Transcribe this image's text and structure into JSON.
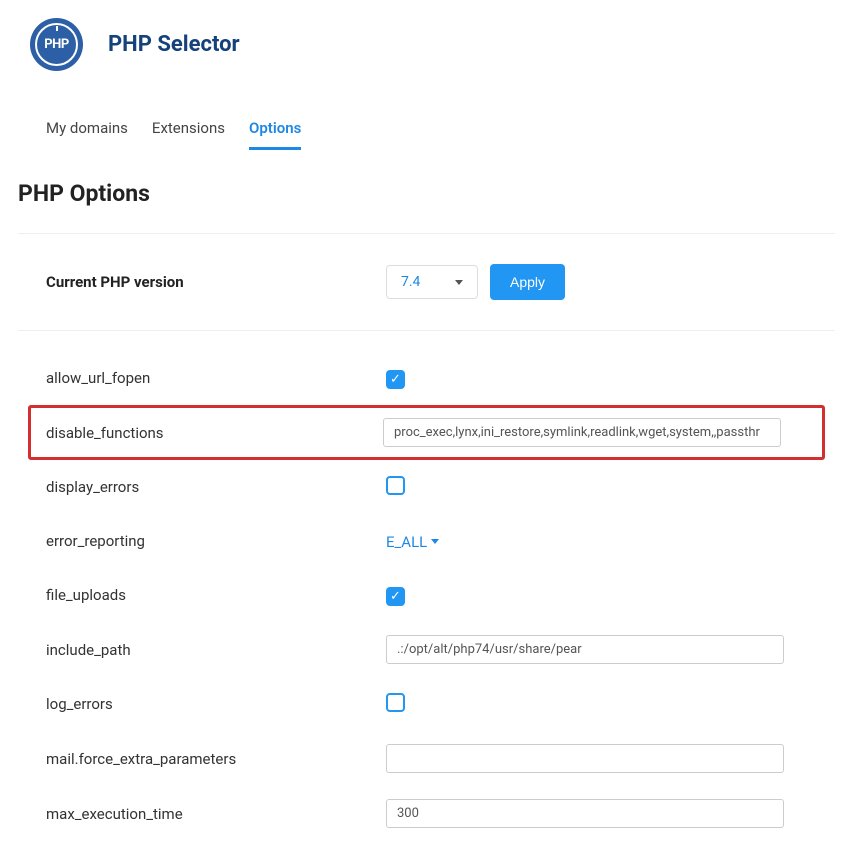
{
  "header": {
    "logo_text": "PHP",
    "title": "PHP Selector"
  },
  "tabs": [
    {
      "label": "My domains",
      "active": false
    },
    {
      "label": "Extensions",
      "active": false
    },
    {
      "label": "Options",
      "active": true
    }
  ],
  "section_title": "PHP Options",
  "version": {
    "label": "Current PHP version",
    "selected": "7.4",
    "apply_label": "Apply"
  },
  "options": [
    {
      "key": "allow_url_fopen",
      "label": "allow_url_fopen",
      "type": "checkbox",
      "checked": true
    },
    {
      "key": "disable_functions",
      "label": "disable_functions",
      "type": "text",
      "value": "proc_exec,lynx,ini_restore,symlink,readlink,wget,system,,passthr",
      "highlight": true
    },
    {
      "key": "display_errors",
      "label": "display_errors",
      "type": "checkbox",
      "checked": false
    },
    {
      "key": "error_reporting",
      "label": "error_reporting",
      "type": "dropdown",
      "value": "E_ALL"
    },
    {
      "key": "file_uploads",
      "label": "file_uploads",
      "type": "checkbox",
      "checked": true
    },
    {
      "key": "include_path",
      "label": "include_path",
      "type": "text",
      "value": ".:/opt/alt/php74/usr/share/pear"
    },
    {
      "key": "log_errors",
      "label": "log_errors",
      "type": "checkbox",
      "checked": false
    },
    {
      "key": "mail_force_extra_parameters",
      "label": "mail.force_extra_parameters",
      "type": "text",
      "value": ""
    },
    {
      "key": "max_execution_time",
      "label": "max_execution_time",
      "type": "text",
      "value": "300"
    }
  ]
}
